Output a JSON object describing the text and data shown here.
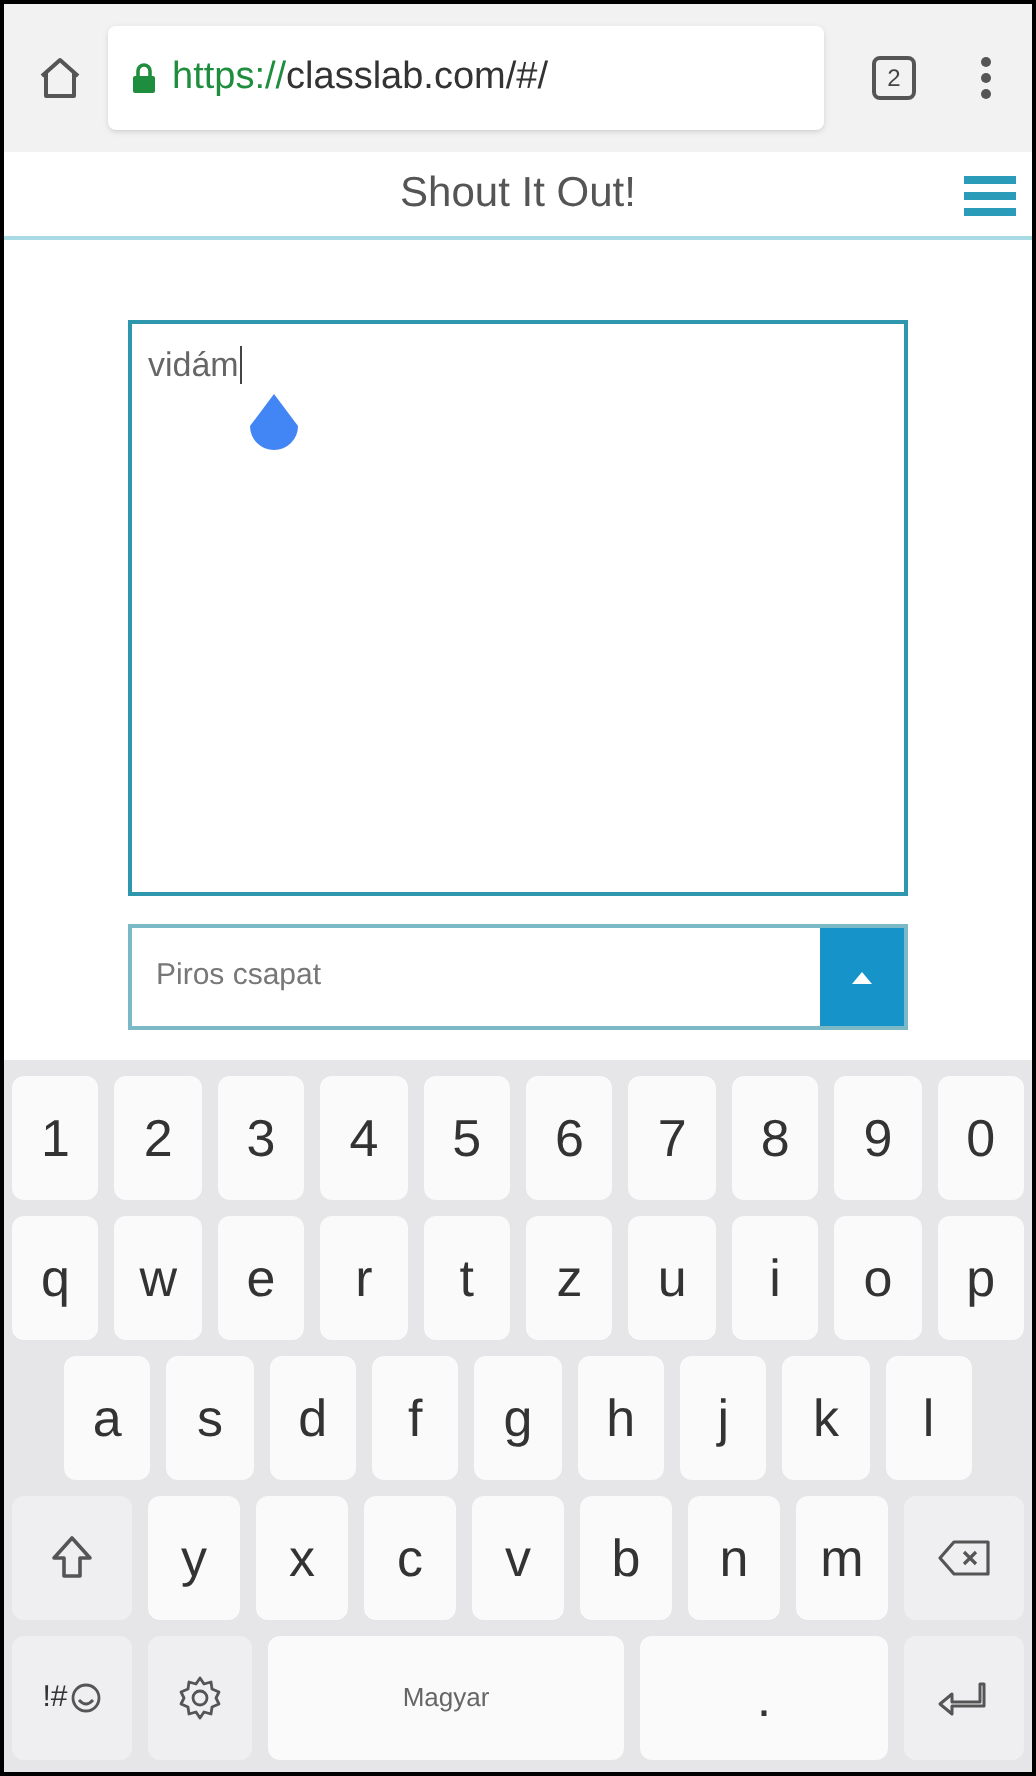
{
  "browser": {
    "url_scheme": "https://",
    "url_rest": "classlab.com/#/",
    "tab_count": "2"
  },
  "header": {
    "title": "Shout It Out!"
  },
  "message": {
    "value": "vidám"
  },
  "team_select": {
    "value": "Piros csapat",
    "open": true
  },
  "keyboard": {
    "rows": [
      [
        {
          "kind": "char",
          "label": "1"
        },
        {
          "kind": "char",
          "label": "2"
        },
        {
          "kind": "char",
          "label": "3"
        },
        {
          "kind": "char",
          "label": "4"
        },
        {
          "kind": "char",
          "label": "5"
        },
        {
          "kind": "char",
          "label": "6"
        },
        {
          "kind": "char",
          "label": "7"
        },
        {
          "kind": "char",
          "label": "8"
        },
        {
          "kind": "char",
          "label": "9"
        },
        {
          "kind": "char",
          "label": "0"
        }
      ],
      [
        {
          "kind": "char",
          "label": "q"
        },
        {
          "kind": "char",
          "label": "w"
        },
        {
          "kind": "char",
          "label": "e"
        },
        {
          "kind": "char",
          "label": "r"
        },
        {
          "kind": "char",
          "label": "t"
        },
        {
          "kind": "char",
          "label": "z"
        },
        {
          "kind": "char",
          "label": "u"
        },
        {
          "kind": "char",
          "label": "i"
        },
        {
          "kind": "char",
          "label": "o"
        },
        {
          "kind": "char",
          "label": "p"
        }
      ],
      [
        {
          "kind": "char",
          "label": "a"
        },
        {
          "kind": "char",
          "label": "s"
        },
        {
          "kind": "char",
          "label": "d"
        },
        {
          "kind": "char",
          "label": "f"
        },
        {
          "kind": "char",
          "label": "g"
        },
        {
          "kind": "char",
          "label": "h"
        },
        {
          "kind": "char",
          "label": "j"
        },
        {
          "kind": "char",
          "label": "k"
        },
        {
          "kind": "char",
          "label": "l"
        }
      ],
      [
        {
          "kind": "shift"
        },
        {
          "kind": "char",
          "label": "y"
        },
        {
          "kind": "char",
          "label": "x"
        },
        {
          "kind": "char",
          "label": "c"
        },
        {
          "kind": "char",
          "label": "v"
        },
        {
          "kind": "char",
          "label": "b"
        },
        {
          "kind": "char",
          "label": "n"
        },
        {
          "kind": "char",
          "label": "m"
        },
        {
          "kind": "backspace"
        }
      ],
      [
        {
          "kind": "symbols",
          "label": "!#"
        },
        {
          "kind": "settings"
        },
        {
          "kind": "space",
          "label": "Magyar"
        },
        {
          "kind": "char",
          "label": "."
        },
        {
          "kind": "enter"
        }
      ]
    ]
  }
}
